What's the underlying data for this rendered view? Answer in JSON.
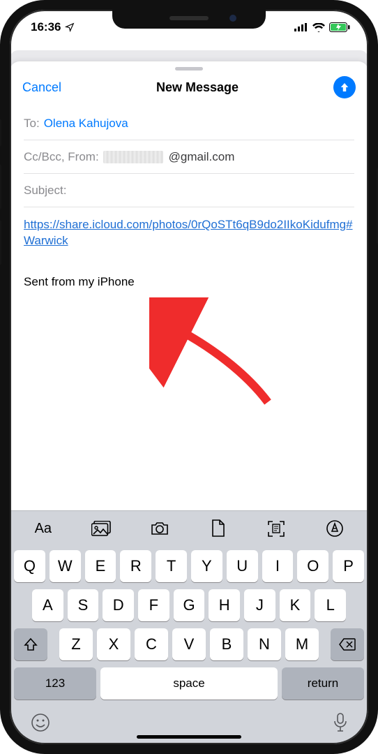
{
  "status": {
    "time": "16:36"
  },
  "sheet": {
    "cancel": "Cancel",
    "title": "New Message"
  },
  "compose": {
    "to_label": "To:",
    "to_value": "Olena Kahujova",
    "ccbcc_label": "Cc/Bcc, From:",
    "from_domain": "@gmail.com",
    "subject_label": "Subject:",
    "body_link": "https://share.icloud.com/photos/0rQoSTt6qB9do2IIkoKidufmg#Warwick",
    "signature": "Sent from my iPhone"
  },
  "keyboard": {
    "toolbar": {
      "format": "Aa"
    },
    "row1": [
      "Q",
      "W",
      "E",
      "R",
      "T",
      "Y",
      "U",
      "I",
      "O",
      "P"
    ],
    "row2": [
      "A",
      "S",
      "D",
      "F",
      "G",
      "H",
      "J",
      "K",
      "L"
    ],
    "row3": [
      "Z",
      "X",
      "C",
      "V",
      "B",
      "N",
      "M"
    ],
    "numbers_key": "123",
    "space_key": "space",
    "return_key": "return"
  }
}
